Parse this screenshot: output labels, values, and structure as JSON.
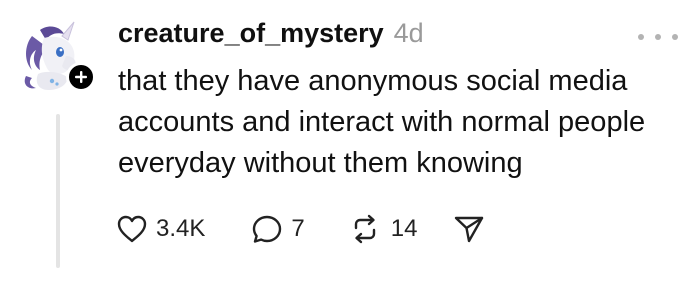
{
  "post": {
    "username": "creature_of_mystery",
    "timestamp": "4d",
    "text": "that they have anonymous social media accounts and interact with normal people everyday without them knowing",
    "avatar_icon": "unicorn-avatar-icon",
    "follow_icon": "plus-icon",
    "more_icon": "more-horizontal-icon"
  },
  "actions": {
    "like": {
      "icon": "heart-icon",
      "count": "3.4K"
    },
    "comment": {
      "icon": "comment-icon",
      "count": "7"
    },
    "repost": {
      "icon": "repost-icon",
      "count": "14"
    },
    "share": {
      "icon": "send-icon"
    }
  },
  "colors": {
    "text": "#111111",
    "muted": "#9a9a9a",
    "thread_line": "#e4e4e4",
    "avatar_purple": "#6b5aa6"
  }
}
